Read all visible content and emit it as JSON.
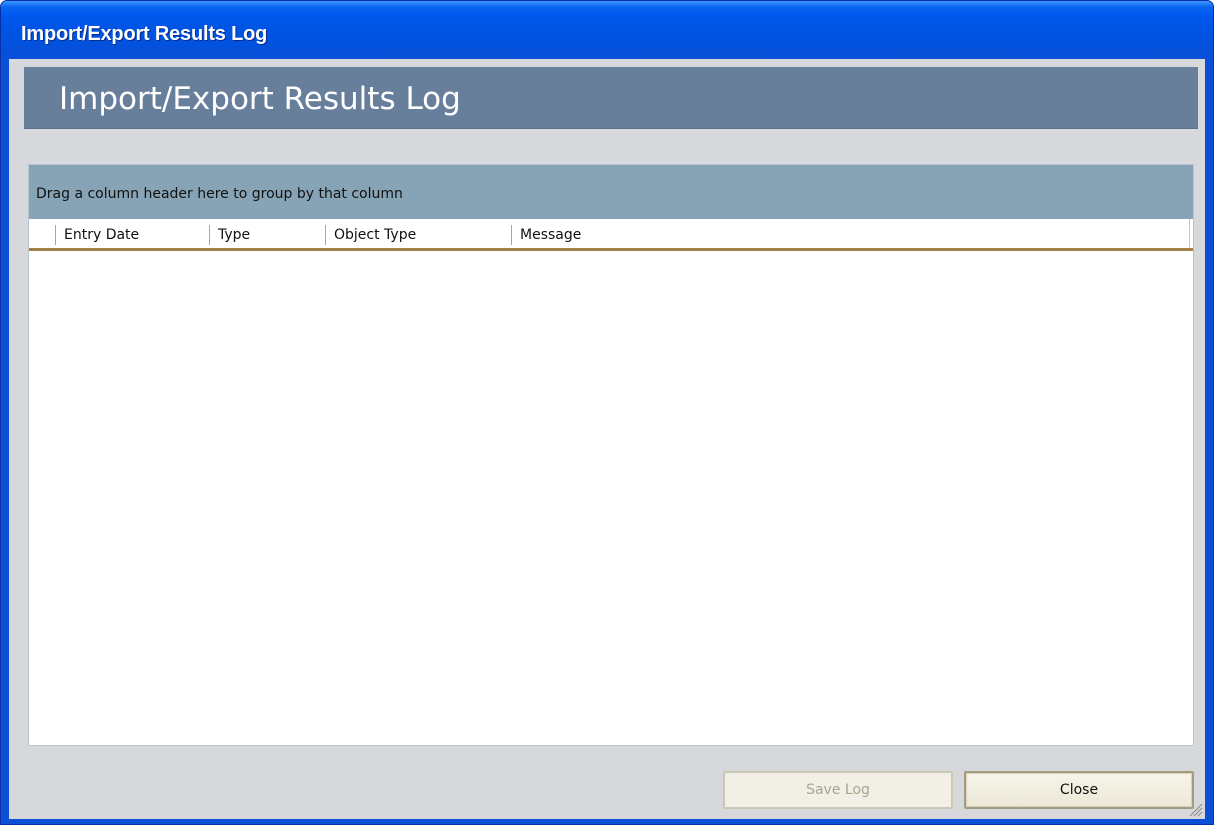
{
  "window": {
    "title": "Import/Export Results Log"
  },
  "banner": {
    "title": "Import/Export Results Log"
  },
  "grid": {
    "group_by_text": "Drag a column header here to group by that column",
    "columns": [
      "Entry Date",
      "Type",
      "Object Type",
      "Message"
    ],
    "rows": []
  },
  "buttons": {
    "save_log": "Save Log",
    "close": "Close"
  },
  "colors": {
    "titlebar": "#0a4fd6",
    "banner": "#687f9c",
    "group_area": "#87a3b6",
    "header_underline": "#a5814a"
  }
}
